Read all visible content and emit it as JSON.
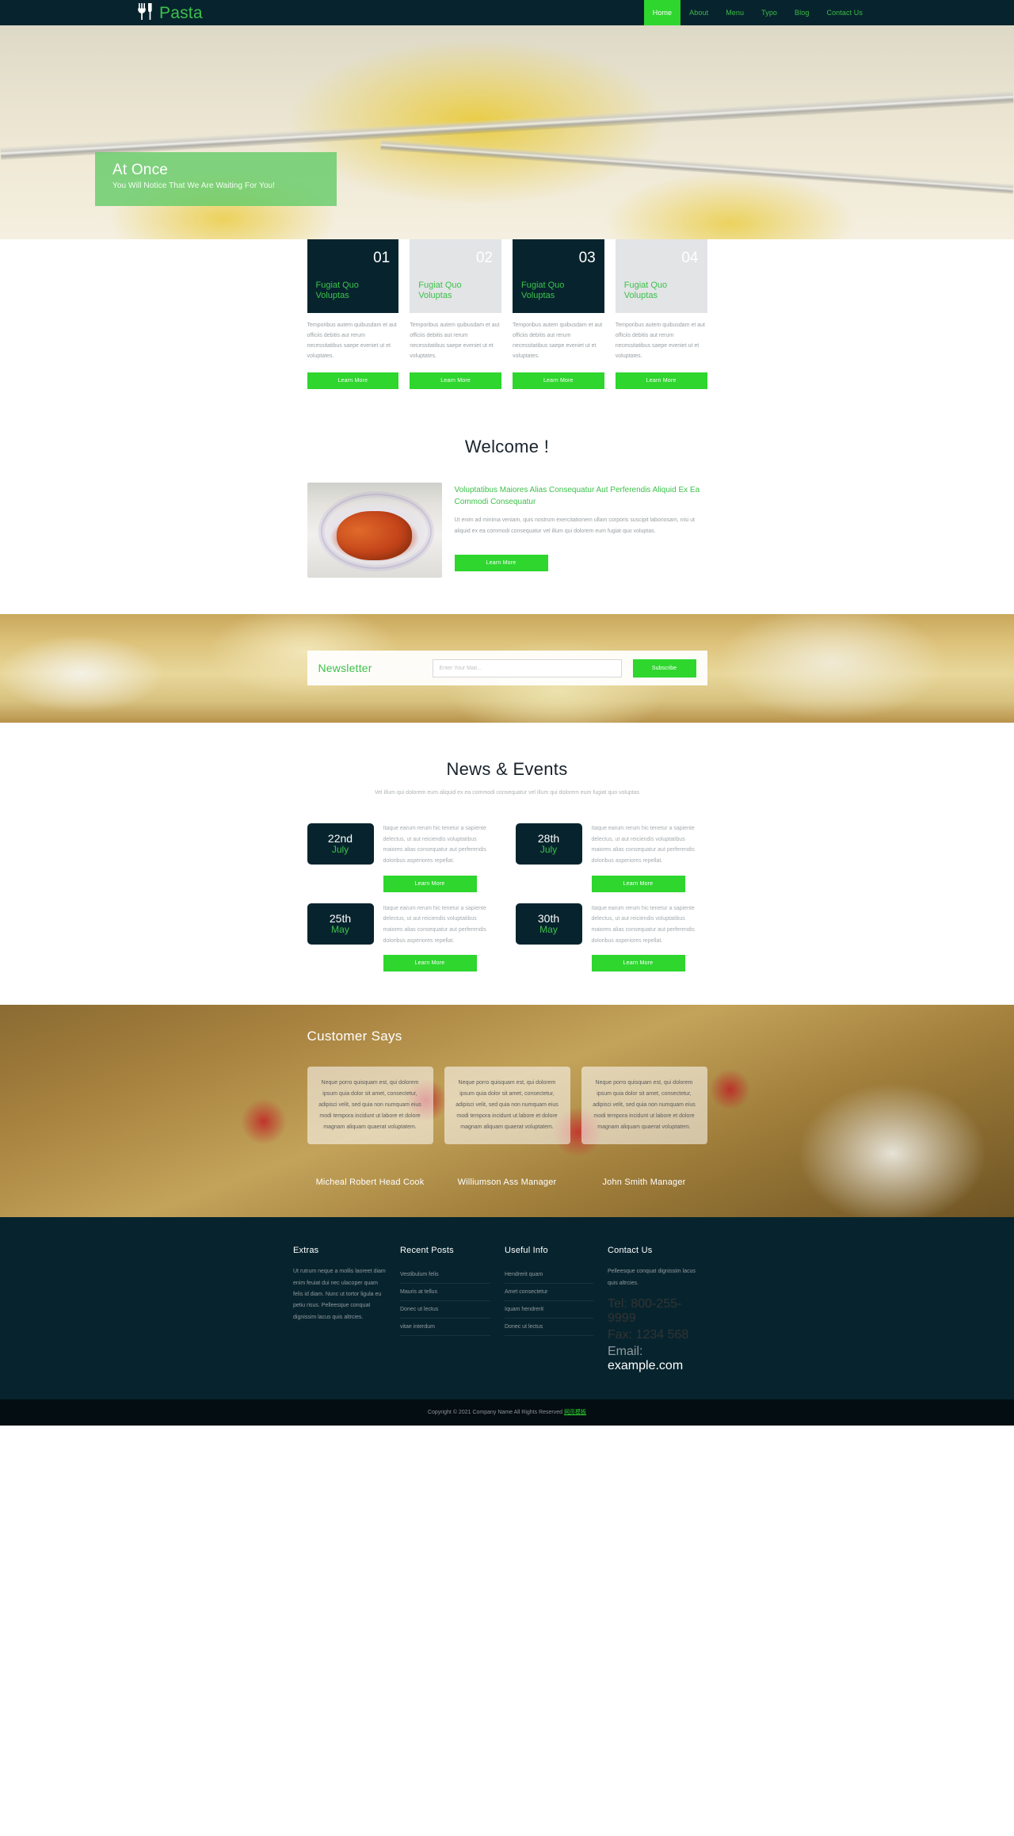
{
  "colors": {
    "dark": "#07242e",
    "green": "#2ed62e",
    "green_text": "#3dc14b",
    "light_box": "#e2e4e6"
  },
  "header": {
    "logo_text": "Pasta",
    "logo_icon": "fork-knife-icon",
    "nav": [
      {
        "label": "Home",
        "active": true
      },
      {
        "label": "About",
        "active": false
      },
      {
        "label": "Menu",
        "active": false
      },
      {
        "label": "Typo",
        "active": false
      },
      {
        "label": "Blog",
        "active": false
      },
      {
        "label": "Contact Us",
        "active": false
      }
    ]
  },
  "hero": {
    "title": "At Once",
    "subtitle": "You Will Notice That We Are Waiting For You!"
  },
  "services": [
    {
      "num": "01",
      "title": "Fugiat Quo Voluptas",
      "desc": "Temporibus autem quibusdam et aut officiis debitis aut rerum necessitatibus saepe eveniet ut et voluptates.",
      "button": "Learn More",
      "style": "dark"
    },
    {
      "num": "02",
      "title": "Fugiat Quo Voluptas",
      "desc": "Temporibus autem quibusdam et aut officiis debitis aut rerum necessitatibus saepe eveniet ut et voluptates.",
      "button": "Learn More",
      "style": "light"
    },
    {
      "num": "03",
      "title": "Fugiat Quo Voluptas",
      "desc": "Temporibus autem quibusdam et aut officiis debitis aut rerum necessitatibus saepe eveniet ut et voluptates.",
      "button": "Learn More",
      "style": "dark"
    },
    {
      "num": "04",
      "title": "Fugiat Quo Voluptas",
      "desc": "Temporibus autem quibusdam et aut officiis debitis aut rerum necessitatibus saepe eveniet ut et voluptates.",
      "button": "Learn More",
      "style": "light"
    }
  ],
  "welcome": {
    "heading": "Welcome !",
    "image_alt": "pasta-plate-photo",
    "subheading": "Voluptatibus Maiores Alias Consequatur Aut Perferendis Aliquid Ex Ea Commodi Consequatur",
    "body": "Ut enim ad minima veniam, quis nostrum exercitationem ullam corporis suscipit laboriosam, nisi ut aliquid ex ea commodi consequatur vel illum qui dolorem eum fugiat quo voluptas.",
    "button": "Learn More"
  },
  "newsletter": {
    "title": "Newsletter",
    "placeholder": "Enter Your Mail...",
    "value": "",
    "button": "Subscribe"
  },
  "news": {
    "heading": "News & Events",
    "subheading": "Vel illum qui dolorem eum aliquid ex ea commodi consequatur vel illum qui dolorem eum fugiat quo voluptas",
    "items": [
      {
        "day": "22nd",
        "month": "July",
        "text": "Itaque earum rerum hic tenetur a sapiente delectus, ut aut reiciendis voluptatibus maiores alias consequatur aut perferendis doloribus asperiores repellat.",
        "button": "Learn More"
      },
      {
        "day": "28th",
        "month": "July",
        "text": "Itaque earum rerum hic tenetur a sapiente delectus, ut aut reiciendis voluptatibus maiores alias consequatur aut perferendis doloribus asperiores repellat.",
        "button": "Learn More"
      },
      {
        "day": "25th",
        "month": "May",
        "text": "Itaque earum rerum hic tenetur a sapiente delectus, ut aut reiciendis voluptatibus maiores alias consequatur aut perferendis doloribus asperiores repellat.",
        "button": "Learn More"
      },
      {
        "day": "30th",
        "month": "May",
        "text": "Itaque earum rerum hic tenetur a sapiente delectus, ut aut reiciendis voluptatibus maiores alias consequatur aut perferendis doloribus asperiores repellat.",
        "button": "Learn More"
      }
    ]
  },
  "testimonials": {
    "heading": "Customer Says",
    "items": [
      {
        "quote": "Neque porro quisquam est, qui dolorem ipsum quia dolor sit amet, consectetur, adipisci velit, sed quia non numquam eius modi tempora incidunt ut labore et dolore magnam aliquam quaerat voluptatem.",
        "name": "Micheal Robert Head Cook"
      },
      {
        "quote": "Neque porro quisquam est, qui dolorem ipsum quia dolor sit amet, consectetur, adipisci velit, sed quia non numquam eius modi tempora incidunt ut labore et dolore magnam aliquam quaerat voluptatem.",
        "name": "Williumson Ass Manager"
      },
      {
        "quote": "Neque porro quisquam est, qui dolorem ipsum quia dolor sit amet, consectetur, adipisci velit, sed quia non numquam eius modi tempora incidunt ut labore et dolore magnam aliquam quaerat voluptatem.",
        "name": "John Smith Manager"
      }
    ]
  },
  "footer": {
    "extras": {
      "title": "Extras",
      "text": "Ut rutrum neque a mollis laoreet diam enim feuiat dui nec ulacoper quam felis id diam. Nunc ut tortor ligula eu petiu risus. Pelleesque conquat dignissim lacus quis altrcies."
    },
    "recent_posts": {
      "title": "Recent Posts",
      "items": [
        "Vestibulum felis",
        "Mauris at tellus",
        "Donec ut lectus",
        "vitae interdum"
      ]
    },
    "useful_info": {
      "title": "Useful Info",
      "items": [
        "Hendrerit quam",
        "Amet consectetur",
        "Iquam hendrerit",
        "Donec ut lectus"
      ]
    },
    "contact": {
      "title": "Contact Us",
      "text": "Pelleesque conquat dignissim lacus quis altrcies.",
      "tel_label": "Tel:",
      "tel": "800-255-9999",
      "fax_label": "Fax:",
      "fax": "1234 568",
      "email_label": "Email:",
      "email": "example.com"
    }
  },
  "copyright": {
    "text": "Copyright © 2021 Company Name All Rights Reserved",
    "link": "网页模板"
  }
}
